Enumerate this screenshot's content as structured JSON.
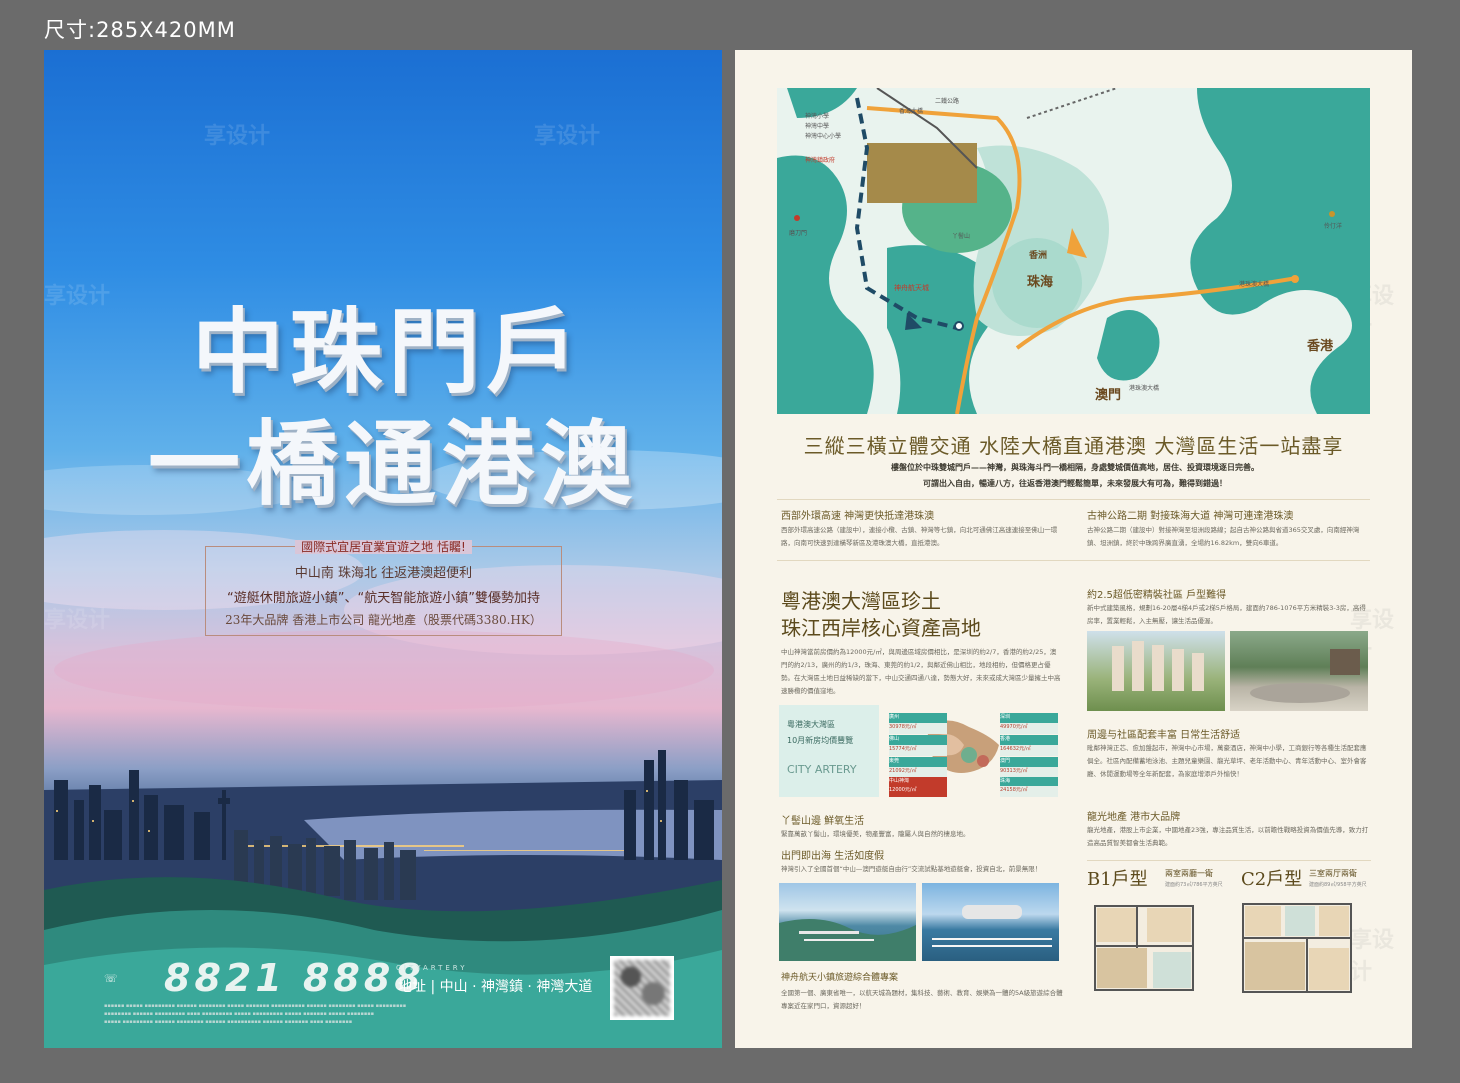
{
  "size_label": "尺寸:285X420MM",
  "watermark": "享设计",
  "left": {
    "headline_1": "中珠門戶",
    "headline_2": "一橋通港澳",
    "info_lines": [
      "國際式宜居宜業宜遊之地 恬矚!",
      "中山南  珠海北  往返港澳超便利",
      "“遊艇休閒旅遊小鎮”、“航天智能旅遊小鎮”雙優勢加持",
      "23年大品牌  香港上市公司  龍光地產（股票代碼3380.HK）"
    ],
    "phone": "8821 8888",
    "brand_small": "CITYARTERY",
    "address": "地址 | 中山 · 神灣鎮 · 神灣大道"
  },
  "right": {
    "map": {
      "places": [
        "香洲",
        "珠海",
        "澳門",
        "香港",
        "氹仔",
        "神舟航天城",
        "丫髻山",
        "港珠澳大橋"
      ],
      "labels": [
        "神灣小學",
        "神灣中學",
        "神灣中心小學",
        "神灣鎮政府",
        "香海大橋",
        "二鐵公路",
        "磨刀門",
        "伶仃洋",
        "港珠澳大橋"
      ]
    },
    "tagline": "三縱三橫立體交通 水陸大橋直通港澳 大灣區生活一站盡享",
    "intro_1": "樓盤位於中珠雙城門戶——神灣，與珠海斗門一橋相隔，身處雙城價值高地，居住、投資環境逐日完善。",
    "intro_2": "可謂出入自由，暢達八方，往返香港澳門輕鬆簡單，未來發展大有可為，難得到錯過！",
    "sections": [
      {
        "title": "西部外環高速  神灣更快抵達港珠澳",
        "text": "西部外環高速公路（建設中），連接小欖、古鎮、神灣等七鎮，向北可通佛江高速連接至佛山一環路，向南可快速到達橫琴新區及港珠澳大橋，直抵港澳。"
      },
      {
        "title": "古神公路二期  對接珠海大道  神灣可連達港珠澳",
        "text": "古神公路二期（建設中）對接神灣至坦洲段路線；起自古神公路與省道365交叉處，向南經神灣鎮、坦洲鎮，終於中珠跨界廣直湧，全場約16.82km，雙向6車道。"
      }
    ],
    "bay_title_1": "粵港澳大灣區珍土",
    "bay_title_2": "珠江西岸核心資產高地",
    "bay_text": "中山神灣當前房價約為12000元/㎡，與周邊區域房價相比，是深圳的約2/7，香港的約2/25，澳門的約2/13，廣州的約1/3，珠海、東莞的約1/2，與鄰近佛山相比，地段相約，但價格更占優勢。在大灣區土地日益稀缺的當下，中山交通四通八達，勢態大好，未來或成大灣區少量擁土中高速勝欖的價值窪地。",
    "chart": {
      "panel_title_1": "粵港澳大灣區",
      "panel_title_2": "10月新房均價豐覽",
      "panel_brand": "CITY ARTERY",
      "prices": [
        "30978元/㎡",
        "15774元/㎡",
        "21092元/㎡",
        "12000元/㎡",
        "49970元/㎡",
        "164632元/㎡",
        "90313元/㎡",
        "24158元/㎡"
      ],
      "cities": [
        "廣州",
        "佛山",
        "東莞",
        "中山神灣",
        "深圳",
        "香港",
        "澳門",
        "珠海"
      ]
    },
    "mountain_title": "丫髻山邊  鮮氧生活",
    "mountain_text": "緊靠萬畝丫髻山，環境優美，物產豐富，隴屬人與自然的棲息地。",
    "sea_title": "出門即出海  生活如度假",
    "sea_text": "神灣引入了全國首個“中山—澳門遊艇自由行”交流試點基地遊艇會，投資自北，前景無限！",
    "town_title": "神舟航天小鎮旅遊綜合體專案",
    "town_text": "全國第一個、廣東省唯一，以航天城為題材，集科技、藝術、教育、娛樂為一體的5A級旅遊綜合體專案近在家門口，資源超好！",
    "community_title": "約2.5超低密精裝社區  戶型難得",
    "community_text": "新中式建築風格，規劃16-20層4梯4戶或2梯5戶格局，建面約786-1076平方米精裝3-3房，高得房率，置業輕鬆，入主無壓，讓生活品優渥。",
    "facility_title": "周邊与社區配套丰富  日常生活舒适",
    "facility_text": "毗鄰神灣正芯、愈加盤起市，神灣中心市場，萬豪酒店，神灣中小學，工商銀行等各種生活配套應俱全。社區內配備蓄地泳池、主題兒童樂園、龍光草坪、老年活動中心、青年活動中心、室外會客廳、休閒運動場等全年新配套，為家庭增添戶外愉快！",
    "brand_title": "龍光地產  港市大品牌",
    "brand_text": "龍光地產，港股上市企業，中國地產23強，專注品質生活，以前瞻性戰略投資為價值先導，致力打造高品質智美都會生活典範。",
    "fp_b1": {
      "name": "B1戶型",
      "sub": "兩室兩廳一衛",
      "area": "建面約73㎡/786平方英尺"
    },
    "fp_c2": {
      "name": "C2戶型",
      "sub": "三室兩厅兩衛",
      "area": "建面約89㎡/958平方英尺"
    }
  },
  "colors": {
    "teal": "#3aa89a",
    "gold": "#6b5a28",
    "route_orange": "#f0a23a",
    "route_navy": "#1f4b66"
  }
}
